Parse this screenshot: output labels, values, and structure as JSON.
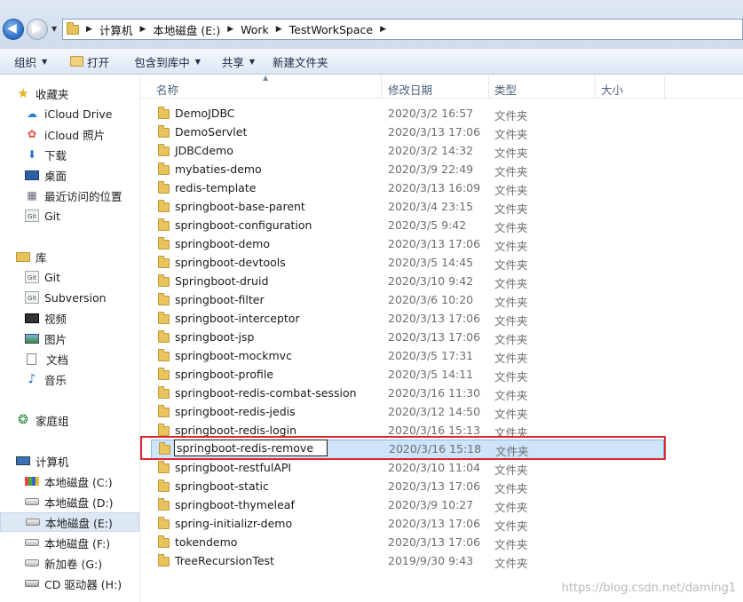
{
  "address": {
    "crumbs": [
      "计算机",
      "本地磁盘 (E:)",
      "Work",
      "TestWorkSpace"
    ]
  },
  "toolbar": {
    "organize": "组织",
    "open": "打开",
    "include_library": "包含到库中",
    "share": "共享",
    "new_folder": "新建文件夹"
  },
  "nav": {
    "favorites": "收藏夹",
    "icloud_drive": "iCloud Drive",
    "icloud_photos": "iCloud 照片",
    "downloads": "下载",
    "desktop": "桌面",
    "recent": "最近访问的位置",
    "git_fav": "Git",
    "libraries": "库",
    "git_lib": "Git",
    "subversion": "Subversion",
    "videos": "视频",
    "pictures": "图片",
    "documents": "文档",
    "music": "音乐",
    "homegroup": "家庭组",
    "computer": "计算机",
    "drive_c": "本地磁盘 (C:)",
    "drive_d": "本地磁盘 (D:)",
    "drive_e": "本地磁盘 (E:)",
    "drive_f": "本地磁盘 (F:)",
    "drive_g": "新加卷 (G:)",
    "drive_h": "CD 驱动器 (H:)"
  },
  "columns": {
    "name": "名称",
    "date": "修改日期",
    "type": "类型",
    "size": "大小"
  },
  "files": [
    {
      "name": "DemoJDBC",
      "date": "2020/3/2 16:57",
      "type": "文件夹"
    },
    {
      "name": "DemoServlet",
      "date": "2020/3/13 17:06",
      "type": "文件夹"
    },
    {
      "name": "JDBCdemo",
      "date": "2020/3/2 14:32",
      "type": "文件夹"
    },
    {
      "name": "mybaties-demo",
      "date": "2020/3/9 22:49",
      "type": "文件夹"
    },
    {
      "name": "redis-template",
      "date": "2020/3/13 16:09",
      "type": "文件夹"
    },
    {
      "name": "springboot-base-parent",
      "date": "2020/3/4 23:15",
      "type": "文件夹"
    },
    {
      "name": "springboot-configuration",
      "date": "2020/3/5 9:42",
      "type": "文件夹"
    },
    {
      "name": "springboot-demo",
      "date": "2020/3/13 17:06",
      "type": "文件夹"
    },
    {
      "name": "springboot-devtools",
      "date": "2020/3/5 14:45",
      "type": "文件夹"
    },
    {
      "name": "Springboot-druid",
      "date": "2020/3/10 9:42",
      "type": "文件夹"
    },
    {
      "name": "springboot-filter",
      "date": "2020/3/6 10:20",
      "type": "文件夹"
    },
    {
      "name": "springboot-interceptor",
      "date": "2020/3/13 17:06",
      "type": "文件夹"
    },
    {
      "name": "springboot-jsp",
      "date": "2020/3/13 17:06",
      "type": "文件夹"
    },
    {
      "name": "springboot-mockmvc",
      "date": "2020/3/5 17:31",
      "type": "文件夹"
    },
    {
      "name": "springboot-profile",
      "date": "2020/3/5 14:11",
      "type": "文件夹"
    },
    {
      "name": "springboot-redis-combat-session",
      "date": "2020/3/16 11:30",
      "type": "文件夹"
    },
    {
      "name": "springboot-redis-jedis",
      "date": "2020/3/12 14:50",
      "type": "文件夹"
    },
    {
      "name": "springboot-redis-login",
      "date": "2020/3/16 15:13",
      "type": "文件夹"
    },
    {
      "name": "springboot-redis-remove",
      "date": "2020/3/16 15:18",
      "type": "文件夹"
    },
    {
      "name": "springboot-restfulAPI",
      "date": "2020/3/10 11:04",
      "type": "文件夹"
    },
    {
      "name": "springboot-static",
      "date": "2020/3/13 17:06",
      "type": "文件夹"
    },
    {
      "name": "springboot-thymeleaf",
      "date": "2020/3/9 10:27",
      "type": "文件夹"
    },
    {
      "name": "spring-initializr-demo",
      "date": "2020/3/13 17:06",
      "type": "文件夹"
    },
    {
      "name": "tokendemo",
      "date": "2020/3/13 17:06",
      "type": "文件夹"
    },
    {
      "name": "TreeRecursionTest",
      "date": "2019/9/30 9:43",
      "type": "文件夹"
    }
  ],
  "watermark": "https://blog.csdn.net/daming1"
}
